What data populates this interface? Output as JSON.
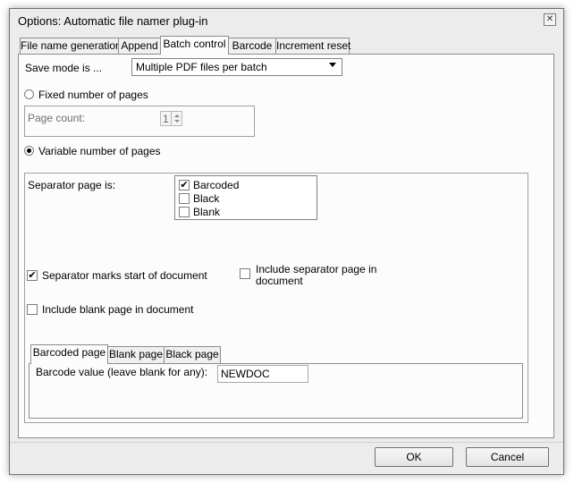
{
  "window": {
    "title": "Options:  Automatic file namer plug-in",
    "close_glyph": "✕"
  },
  "tabs": [
    {
      "label": "File name generation"
    },
    {
      "label": "Append"
    },
    {
      "label": "Batch control",
      "active": true
    },
    {
      "label": "Barcode"
    },
    {
      "label": "Increment reset"
    }
  ],
  "save_mode": {
    "label": "Save mode is ...",
    "value": "Multiple PDF files per batch"
  },
  "fixed_pages": {
    "label": "Fixed number of pages",
    "selected": false,
    "page_count_label": "Page count:",
    "page_count_value": "1"
  },
  "variable_pages": {
    "label": "Variable number of pages",
    "selected": true
  },
  "separator": {
    "label": "Separator page is:",
    "options": [
      {
        "label": "Barcoded",
        "checked": true
      },
      {
        "label": "Black",
        "checked": false
      },
      {
        "label": "Blank",
        "checked": false
      }
    ],
    "marks_start_label": "Separator marks start of document",
    "marks_start_checked": true,
    "include_separator_label_1": "Include separator page in",
    "include_separator_label_2": "document",
    "include_separator_checked": false,
    "include_blank_label": "Include blank page in document",
    "include_blank_checked": false
  },
  "subtabs": [
    {
      "label": "Barcoded page",
      "active": true
    },
    {
      "label": "Blank page"
    },
    {
      "label": "Black page"
    }
  ],
  "barcode": {
    "label": "Barcode value (leave blank for any):",
    "value": "NEWDOC"
  },
  "buttons": {
    "ok": "OK",
    "cancel": "Cancel"
  },
  "check_glyph": "✔"
}
